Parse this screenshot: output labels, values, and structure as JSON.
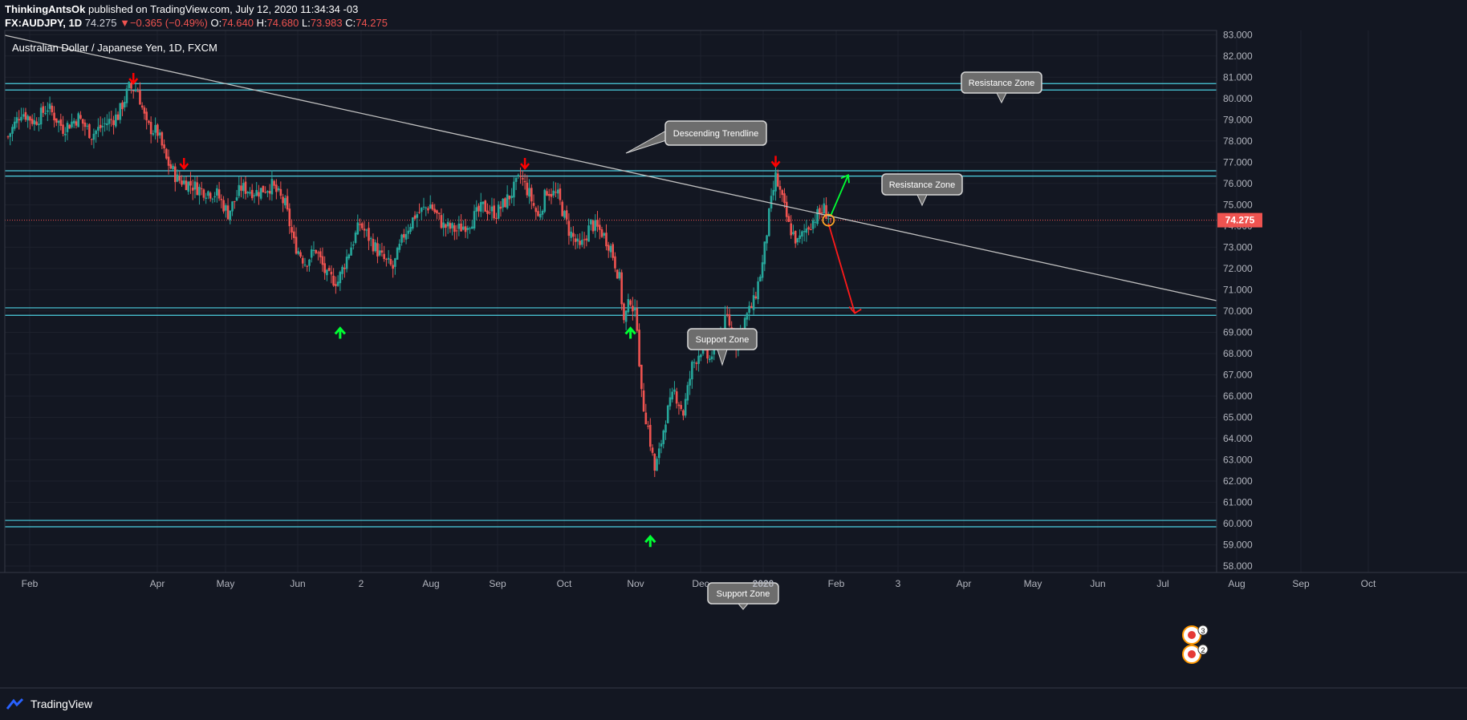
{
  "header": {
    "author": "ThinkingAntsOk",
    "published": " published on TradingView.com, July 12, 2020 11:34:34 -03",
    "symbol": "FX:AUDJPY, 1D",
    "last": "74.275",
    "change_arrow": "▼",
    "change": "−0.365 (−0.49%)",
    "o_label": "O:",
    "o_value": "74.640",
    "h_label": "H:",
    "h_value": "74.680",
    "l_label": "L:",
    "l_value": "73.983",
    "c_label": "C:",
    "c_value": "74.275"
  },
  "footer": {
    "brand": "TradingView",
    "logo_icon": "tradingview-logo-icon"
  },
  "colors": {
    "background": "#131722",
    "grid": "#1e222d",
    "up": "#26a69a",
    "down": "#ef5350",
    "zone_line": "#4dd0e1",
    "trendline": "#c0c0c0",
    "marker_down": "#ff0000",
    "marker_up": "#00ff33",
    "last_price_bg": "#ef5350"
  },
  "chart_data": {
    "type": "candlestick",
    "title": "Australian Dollar / Japanese Yen, 1D, FXCM",
    "x_tick_labels": [
      "Feb",
      "Apr",
      "May",
      "Jun",
      "2",
      "Aug",
      "Sep",
      "Oct",
      "Nov",
      "Dec",
      "2020",
      "Feb",
      "3",
      "Apr",
      "May",
      "Jun",
      "Jul",
      "Aug",
      "Sep",
      "Oct"
    ],
    "ylim": [
      57.7,
      83.2
    ],
    "y_tick_labels": [
      "83.000",
      "82.000",
      "81.000",
      "80.000",
      "79.000",
      "78.000",
      "77.000",
      "76.000",
      "75.000",
      "74.000",
      "73.000",
      "72.000",
      "71.000",
      "70.000",
      "69.000",
      "68.000",
      "67.000",
      "66.000",
      "65.000",
      "64.000",
      "63.000",
      "62.000",
      "61.000",
      "60.000",
      "59.000",
      "58.000"
    ],
    "last_price": 74.275,
    "last_price_label": "74.275",
    "zones": [
      {
        "label": "Resistance Zone",
        "upper": 80.7,
        "lower": 80.4
      },
      {
        "label": "Resistance Zone",
        "upper": 76.6,
        "lower": 76.35
      },
      {
        "label": "Support Zone",
        "upper": 70.15,
        "lower": 69.8
      },
      {
        "label": "Support Zone",
        "upper": 60.15,
        "lower": 59.85
      }
    ],
    "trendline_label": "Descending Trendline",
    "price_path": [
      {
        "t": 0,
        "p": 78.2
      },
      {
        "t": 6,
        "p": 79.4
      },
      {
        "t": 12,
        "p": 78.9
      },
      {
        "t": 18,
        "p": 79.6
      },
      {
        "t": 25,
        "p": 78.6
      },
      {
        "t": 32,
        "p": 79.1
      },
      {
        "t": 38,
        "p": 78.3
      },
      {
        "t": 44,
        "p": 78.8
      },
      {
        "t": 50,
        "p": 79.2
      },
      {
        "t": 55,
        "p": 80.5
      },
      {
        "t": 59,
        "p": 80.4
      },
      {
        "t": 63,
        "p": 78.7
      },
      {
        "t": 68,
        "p": 78.4
      },
      {
        "t": 72,
        "p": 77.1
      },
      {
        "t": 77,
        "p": 76.2
      },
      {
        "t": 82,
        "p": 76.0
      },
      {
        "t": 88,
        "p": 75.7
      },
      {
        "t": 95,
        "p": 75.5
      },
      {
        "t": 100,
        "p": 74.6
      },
      {
        "t": 106,
        "p": 75.8
      },
      {
        "t": 113,
        "p": 75.6
      },
      {
        "t": 120,
        "p": 75.9
      },
      {
        "t": 126,
        "p": 75.0
      },
      {
        "t": 130,
        "p": 73.2
      },
      {
        "t": 135,
        "p": 72.3
      },
      {
        "t": 140,
        "p": 72.9
      },
      {
        "t": 145,
        "p": 71.6
      },
      {
        "t": 150,
        "p": 71.4
      },
      {
        "t": 155,
        "p": 72.8
      },
      {
        "t": 160,
        "p": 74.1
      },
      {
        "t": 165,
        "p": 73.3
      },
      {
        "t": 170,
        "p": 72.5
      },
      {
        "t": 175,
        "p": 72.0
      },
      {
        "t": 180,
        "p": 73.6
      },
      {
        "t": 185,
        "p": 74.5
      },
      {
        "t": 192,
        "p": 75.0
      },
      {
        "t": 198,
        "p": 74.0
      },
      {
        "t": 204,
        "p": 73.8
      },
      {
        "t": 210,
        "p": 74.2
      },
      {
        "t": 216,
        "p": 74.9
      },
      {
        "t": 222,
        "p": 74.6
      },
      {
        "t": 228,
        "p": 75.4
      },
      {
        "t": 233,
        "p": 76.3
      },
      {
        "t": 237,
        "p": 75.5
      },
      {
        "t": 241,
        "p": 74.4
      },
      {
        "t": 245,
        "p": 75.7
      },
      {
        "t": 250,
        "p": 75.4
      },
      {
        "t": 255,
        "p": 73.8
      },
      {
        "t": 260,
        "p": 72.9
      },
      {
        "t": 265,
        "p": 74.1
      },
      {
        "t": 270,
        "p": 73.7
      },
      {
        "t": 274,
        "p": 73.0
      },
      {
        "t": 278,
        "p": 71.5
      },
      {
        "t": 280,
        "p": 69.5
      },
      {
        "t": 283,
        "p": 70.6
      },
      {
        "t": 286,
        "p": 69.4
      },
      {
        "t": 288,
        "p": 66.0
      },
      {
        "t": 291,
        "p": 64.5
      },
      {
        "t": 294,
        "p": 62.5
      },
      {
        "t": 296,
        "p": 63.3
      },
      {
        "t": 299,
        "p": 65.0
      },
      {
        "t": 303,
        "p": 66.2
      },
      {
        "t": 307,
        "p": 65.2
      },
      {
        "t": 311,
        "p": 67.4
      },
      {
        "t": 315,
        "p": 68.2
      },
      {
        "t": 319,
        "p": 67.7
      },
      {
        "t": 323,
        "p": 68.8
      },
      {
        "t": 327,
        "p": 69.7
      },
      {
        "t": 331,
        "p": 68.5
      },
      {
        "t": 335,
        "p": 69.6
      },
      {
        "t": 339,
        "p": 70.4
      },
      {
        "t": 343,
        "p": 72.2
      },
      {
        "t": 346,
        "p": 74.5
      },
      {
        "t": 349,
        "p": 76.3
      },
      {
        "t": 352,
        "p": 75.2
      },
      {
        "t": 355,
        "p": 74.0
      },
      {
        "t": 359,
        "p": 73.2
      },
      {
        "t": 363,
        "p": 73.9
      },
      {
        "t": 367,
        "p": 74.4
      },
      {
        "t": 371,
        "p": 74.8
      },
      {
        "t": 374,
        "p": 74.275
      }
    ],
    "swing_markers": [
      {
        "direction": "down",
        "x": 57,
        "y": 80.9
      },
      {
        "direction": "down",
        "x": 80,
        "y": 76.9
      },
      {
        "direction": "down",
        "x": 235,
        "y": 76.9
      },
      {
        "direction": "down",
        "x": 349,
        "y": 77.0
      },
      {
        "direction": "up",
        "x": 151,
        "y": 69.0
      },
      {
        "direction": "up",
        "x": 283,
        "y": 69.0
      },
      {
        "direction": "up",
        "x": 292,
        "y": 59.2
      }
    ],
    "projection": {
      "origin": {
        "x": 373,
        "y": 74.275
      },
      "bullish_target": {
        "x": 382,
        "y": 76.4
      },
      "bearish_target": {
        "x": 385,
        "y": 69.9
      }
    },
    "event_badges": [
      "3",
      "2"
    ]
  }
}
